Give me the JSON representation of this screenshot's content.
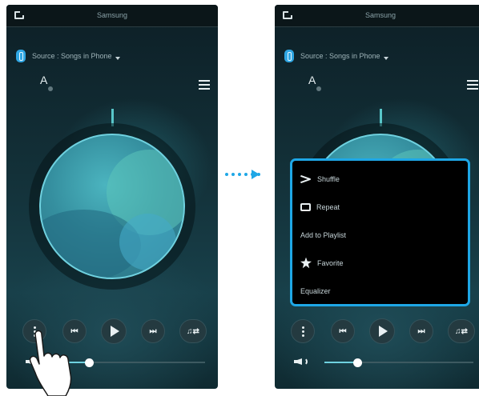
{
  "left_screen": {
    "status_title": "Samsung",
    "source_text": "Source : Songs in Phone",
    "volume_label": "A",
    "controls": {
      "more_icon": "more-vertical-icon",
      "prev_label": "⏮",
      "next_label": "⏭",
      "swap_label": "♫⇄"
    },
    "volume_level": 0.22
  },
  "right_screen": {
    "status_title": "Samsung",
    "source_text": "Source : Songs in Phone",
    "volume_label": "A",
    "controls": {
      "prev_label": "⏮",
      "next_label": "⏭",
      "swap_label": "♫⇄"
    },
    "volume_level": 0.22,
    "menu": {
      "items": [
        {
          "label": "Shuffle",
          "icon": "shuffle-icon"
        },
        {
          "label": "Repeat",
          "icon": "repeat-icon"
        },
        {
          "label": "Add to Playlist",
          "icon": ""
        },
        {
          "label": "Favorite",
          "icon": "star-icon"
        },
        {
          "label": "Equalizer",
          "icon": ""
        }
      ],
      "border_color": "#1ea7e6"
    }
  },
  "colors": {
    "accent": "#1ea7e6",
    "dial_ring": "#6fd1df"
  }
}
